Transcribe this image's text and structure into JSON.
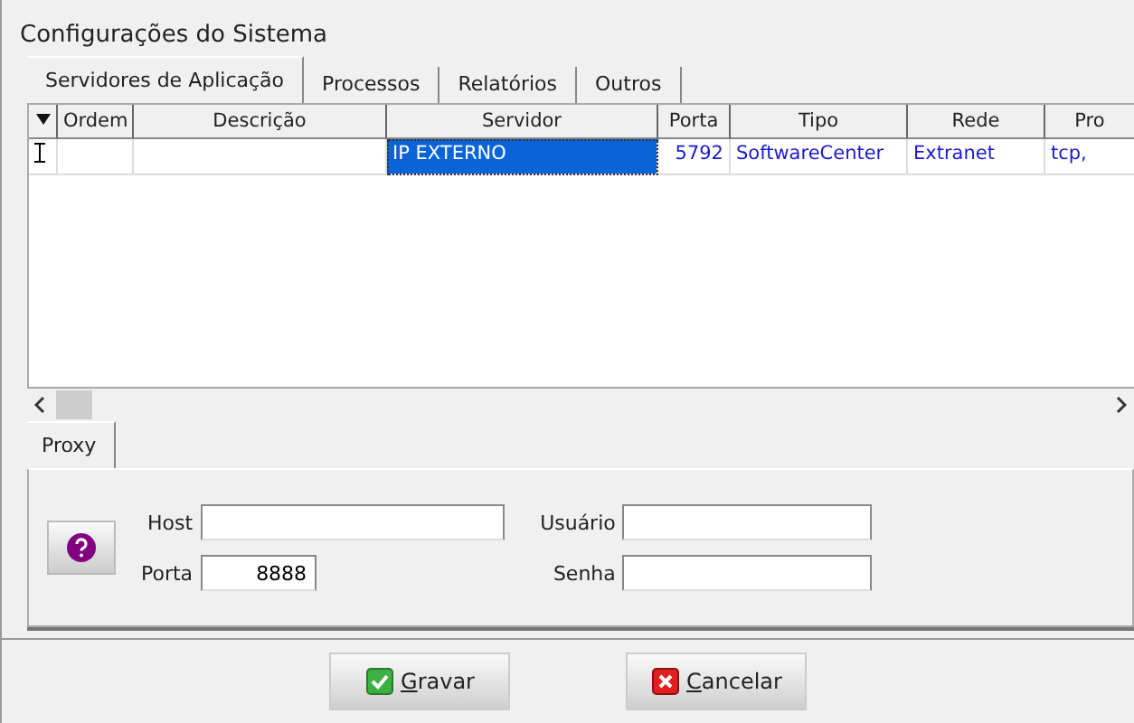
{
  "window": {
    "title": "Configurações do Sistema"
  },
  "tabs": [
    {
      "label": "Servidores de Aplicação",
      "selected": true
    },
    {
      "label": "Processos",
      "selected": false
    },
    {
      "label": "Relatórios",
      "selected": false
    },
    {
      "label": "Outros",
      "selected": false
    }
  ],
  "table": {
    "columns": [
      "Ordem",
      "Descrição",
      "Servidor",
      "Porta",
      "Tipo",
      "Rede",
      "Pro"
    ],
    "rows": [
      {
        "cells": [
          {
            "text": "",
            "focused": false
          },
          {
            "text": "",
            "focused": false
          },
          {
            "text": "IP EXTERNO",
            "focused": true
          },
          {
            "text": "5792",
            "focused": false
          },
          {
            "text": "SoftwareCenter",
            "focused": false
          },
          {
            "text": "Extranet",
            "focused": false
          },
          {
            "text": "tcp,",
            "focused": false
          }
        ]
      }
    ]
  },
  "proxy": {
    "tabs": [
      {
        "label": "Proxy",
        "selected": true
      }
    ],
    "fields": [
      {
        "label": "Host"
      },
      {
        "label": "Porta",
        "value": "8888"
      },
      {
        "label": "Usuário"
      },
      {
        "label": "Senha"
      }
    ]
  },
  "buttons": [
    {
      "kind": "ok",
      "label": "Gravar"
    },
    {
      "kind": "cancel",
      "label": "Cancelar"
    }
  ]
}
